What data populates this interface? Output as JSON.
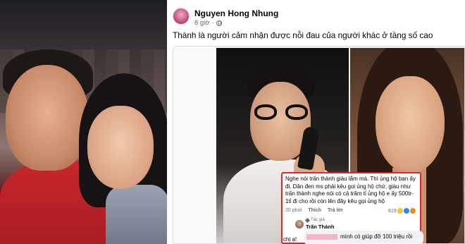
{
  "post": {
    "author": "Nguyen Hong Nhung",
    "time": "8 giờ",
    "separator": "·",
    "privacy_icon": "globe-icon",
    "caption": "Thành là người cảm nhận được nỗi đau của người khác ở tầng số cao"
  },
  "comment": {
    "text": "Nghe nói trấn thành giàu lắm mà. Thì ủng hộ bạn ấy đi. Dân đen ms phải kêu gọi ủng hộ chứ, giàu như trấn thành nghe nói có cả trăm tỉ ủng hộ e ấy 500tr-1tỉ đi cho rồi còn lên đây kêu gọi ủng hộ",
    "time": "20 phút",
    "like_label": "Thích",
    "reply_label": "Trả lời",
    "reaction_count": "619",
    "reaction_icons": [
      "haha-icon",
      "like-icon",
      "sad-icon"
    ]
  },
  "reply": {
    "badge": "Tác giả",
    "author": "Trấn Thành",
    "text_line1": "mình có giúp đỡ 100 triệu rồi",
    "text_line2": "chị ạ!"
  }
}
